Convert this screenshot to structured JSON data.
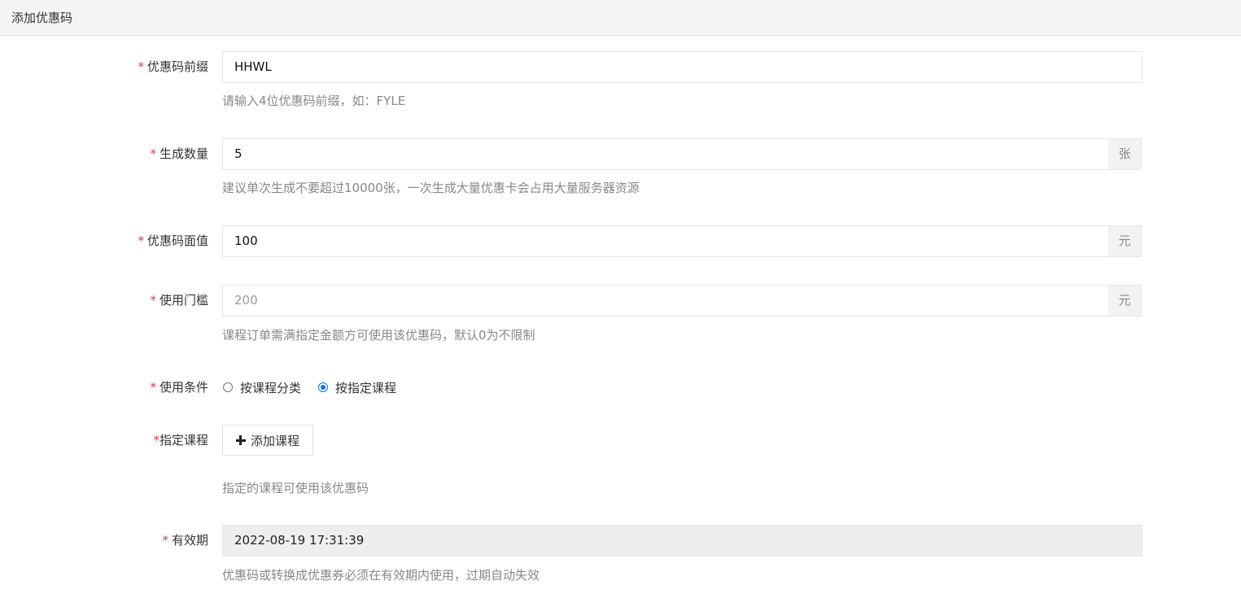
{
  "header": {
    "title": "添加优惠码"
  },
  "form": {
    "prefix": {
      "required_mark": "*",
      "label": "优惠码前缀",
      "value": "HHWL",
      "hint": "请输入4位优惠码前缀，如：FYLE"
    },
    "quantity": {
      "required_mark": "*",
      "label": "生成数量",
      "value": "5",
      "unit": "张",
      "hint": "建议单次生成不要超过10000张，一次生成大量优惠卡会占用大量服务器资源"
    },
    "face_value": {
      "required_mark": "*",
      "label": "优惠码面值",
      "value": "100",
      "unit": "元"
    },
    "threshold": {
      "required_mark": "*",
      "label": "使用门槛",
      "placeholder": "200",
      "unit": "元",
      "hint": "课程订单需满指定金额方可使用该优惠码，默认0为不限制"
    },
    "condition": {
      "required_mark": "*",
      "label": "使用条件",
      "options": [
        {
          "label": "按课程分类",
          "checked": false
        },
        {
          "label": "按指定课程",
          "checked": true
        }
      ]
    },
    "courses": {
      "required_mark": "*",
      "label": "指定课程",
      "add_button_label": "添加课程",
      "add_button_icon": "plus-icon",
      "hint": "指定的课程可使用该优惠码"
    },
    "validity": {
      "required_mark": "*",
      "label": "有效期",
      "value": "2022-08-19 17:31:39",
      "hint": "优惠码或转换成优惠券必须在有效期内使用，过期自动失效"
    }
  },
  "colors": {
    "required": "#e4393c",
    "radio_checked": "#0075ff",
    "hint_text": "#888888",
    "header_bg": "#f5f5f5"
  }
}
